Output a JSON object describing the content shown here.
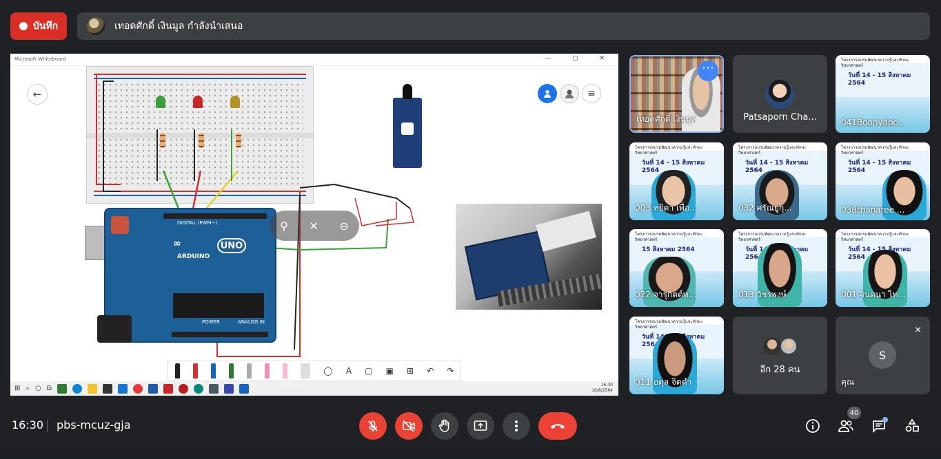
{
  "record": {
    "label": "บันทึก"
  },
  "presenter": {
    "text": "เทอดศักดิ์ เงินมูล กำลังนำเสนอ"
  },
  "whiteboard": {
    "title": "Microsoft Whiteboard",
    "window_controls": "— ▢ ✕",
    "back_icon": "←",
    "menu_icon": "≡",
    "board_label": "DIGITAL (PWM~)",
    "logo_text": "ARDUINO",
    "uno_text": "UNO",
    "power_label": "POWER",
    "analog_label": "ANALOG IN",
    "taskbar_time": "16:30",
    "taskbar_date": "16/8/2564"
  },
  "tiles": [
    {
      "name": "เทอดศักดิ์ เงินมูล"
    },
    {
      "name": "Patsaporn Cha..."
    },
    {
      "name": "041Boonyapo...",
      "date": "วันที่ 14 - 15 สิงหาคม 2564"
    },
    {
      "name": "003 ทยิดา เพื่อ...",
      "date": "วันที่ 14 - 15 สิงหาคม 2564"
    },
    {
      "name": "032 ศรัณยูกุ...",
      "date": "วันที่ 14 - 15 สิงหาคม 2564"
    },
    {
      "name": "038thanaree ...",
      "date": "วันที่ 14 - 15 สิงหาคม 2564"
    },
    {
      "name": "022 จารุกิตต์ห...",
      "date": "15 สิงหาคม 2564"
    },
    {
      "name": "013 วัชรพงษ์",
      "date": "วันที่ 14 - 15 สิงหาคม 2564"
    },
    {
      "name": "001 จินดนา ไท...",
      "date": "วันที่ 14 - 15 สิงหาคม 2564"
    },
    {
      "name": "011 อดุล จิตดำ",
      "date": "วันที่ 14 - 15 สิงหาคม 2564"
    },
    {
      "name": "อีก 28 คน"
    },
    {
      "name": "คุณ",
      "initial": "S"
    }
  ],
  "slide_title": "โครงการอบรมพัฒนาความรู้และทักษะวิทยาศาสตร์",
  "bottom": {
    "time": "16:30",
    "meeting_code": "pbs-mcuz-gja",
    "participant_count": "40"
  },
  "colors": {
    "accent_red": "#ea4335",
    "accent_blue": "#8ab4f8",
    "bg": "#202124",
    "panel": "#3c4043"
  }
}
